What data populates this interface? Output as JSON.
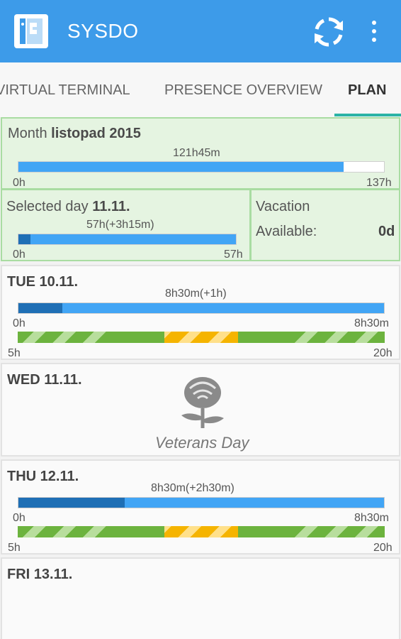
{
  "app": {
    "title": "SYSDO"
  },
  "tabs": [
    {
      "label": "VIRTUAL TERMINAL"
    },
    {
      "label": "PRESENCE OVERVIEW"
    },
    {
      "label": "PLAN"
    }
  ],
  "month": {
    "prefix": "Month",
    "name": "listopad 2015",
    "total": "121h45m",
    "min_label": "0h",
    "max_label": "137h",
    "progress": 0.889
  },
  "selected_day": {
    "prefix": "Selected day",
    "date": "11.11.",
    "total": "57h(+3h15m)",
    "min_label": "0h",
    "max_label": "57h",
    "dark_progress": 0.057,
    "progress": 1.0
  },
  "vacation": {
    "title": "Vacation",
    "available_label": "Available:",
    "available_value": "0d"
  },
  "days": [
    {
      "title": "TUE 10.11.",
      "total": "8h30m(+1h)",
      "min_label": "0h",
      "max_label": "8h30m",
      "dark_progress": 0.12,
      "progress": 1.0,
      "range_start": "5h",
      "range_end": "20h"
    },
    {
      "title": "WED 11.11.",
      "holiday": "Veterans Day",
      "icon": "rose-icon"
    },
    {
      "title": "THU 12.11.",
      "total": "8h30m(+2h30m)",
      "min_label": "0h",
      "max_label": "8h30m",
      "dark_progress": 0.29,
      "progress": 1.0,
      "range_start": "5h",
      "range_end": "20h"
    },
    {
      "title": "FRI 13.11."
    }
  ],
  "colors": {
    "appbar": "#3d9be9",
    "bar": "#42a5f5",
    "bar_dark": "#1f6fb5",
    "summary_bg": "#e5f4e1",
    "tab_indicator": "#2bb3a6"
  }
}
